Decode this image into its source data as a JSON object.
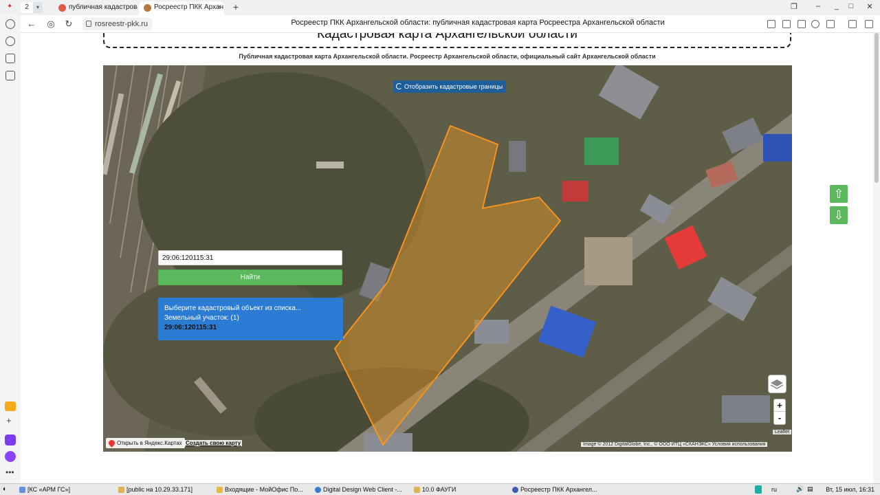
{
  "browser": {
    "tab_count": "2",
    "tabs": [
      {
        "label": "публичная кадастрова",
        "active": false
      },
      {
        "label": "Росреестр ПКК Архан",
        "active": true
      }
    ],
    "url": "rosreestr-pkk.ru",
    "page_title": "Росреестр ПКК Архангельской области: публичная кадастровая карта Росреестра Архангельской области"
  },
  "page": {
    "header": "Кадастровая карта Архангельской области",
    "subtitle": "Публичная кадастровая карта Архангельской области. Росреестр Архангельской области, официальный сайт Архангельской области"
  },
  "map": {
    "toggle_label": "Отобразить кадастровые границы",
    "search_value": "29:06:120115:31",
    "find_label": "Найти",
    "results": {
      "prompt": "Выберите кадастровый объект из списка...",
      "category": "Земельный участок: (1)",
      "item": "29:06:120115:31"
    },
    "zoom_in": "+",
    "zoom_out": "-",
    "leaflet": "Leaflet",
    "ya_open": "Открыть в Яндекс.Картах",
    "ya_create": "Создать свою карту",
    "attribution": "Image © 2012 DigitalGlobe, Inc., © ООО ИТЦ «СКАНЭКС» Условия использования",
    "parcel_color": "#f7931e"
  },
  "side_buttons": {
    "up": "⇧",
    "down": "⇩"
  },
  "taskbar": {
    "items": [
      "[КС «АРМ ГС»]",
      "[public на 10.29.33.171]",
      "Входящие - МойОфис По...",
      "Digital Design Web Client -...",
      "10.0 ФАУГИ",
      "Росреестр ПКК Архангел..."
    ],
    "lang": "ru",
    "clock": "Вт, 15 июл, 16:31"
  }
}
